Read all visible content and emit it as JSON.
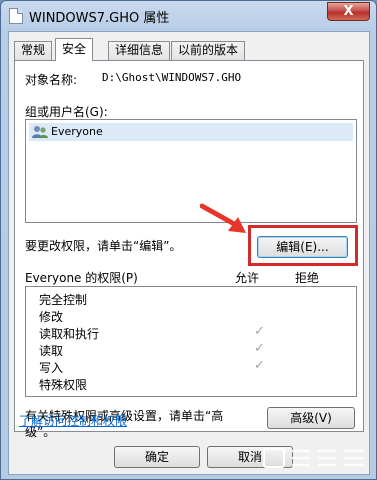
{
  "window": {
    "title": "WINDOWS7.GHO 属性",
    "close_label": "X"
  },
  "tabs": [
    {
      "label": "常规",
      "active": false
    },
    {
      "label": "安全",
      "active": true
    },
    {
      "label": "详细信息",
      "active": false
    },
    {
      "label": "以前的版本",
      "active": false
    }
  ],
  "security": {
    "object_name_label": "对象名称:",
    "object_name_value": "D:\\Ghost\\WINDOWS7.GHO",
    "groups_label": "组或用户名(G):",
    "groups": [
      {
        "name": "Everyone",
        "icon": "users-icon"
      }
    ],
    "change_prompt": "要更改权限，请单击“编辑”。",
    "edit_button": "编辑(E)...",
    "permissions_label": "Everyone 的权限(P)",
    "allow_header": "允许",
    "deny_header": "拒绝",
    "permissions": [
      {
        "name": "完全控制",
        "allow": false,
        "deny": false
      },
      {
        "name": "修改",
        "allow": false,
        "deny": false
      },
      {
        "name": "读取和执行",
        "allow": true,
        "deny": false
      },
      {
        "name": "读取",
        "allow": true,
        "deny": false
      },
      {
        "name": "写入",
        "allow": true,
        "deny": false
      },
      {
        "name": "特殊权限",
        "allow": false,
        "deny": false
      }
    ],
    "advanced_prompt_line1": "有关特殊权限或高级设置，请单击“高",
    "advanced_prompt_line2": "级”。",
    "advanced_button": "高级(V)",
    "learn_link": "了解访问控制和权限"
  },
  "footer": {
    "ok_button": "确定",
    "cancel_button": "取消"
  },
  "colors": {
    "callout": "#d42a2a",
    "arrow": "#e8352a",
    "link": "#0066cc"
  }
}
